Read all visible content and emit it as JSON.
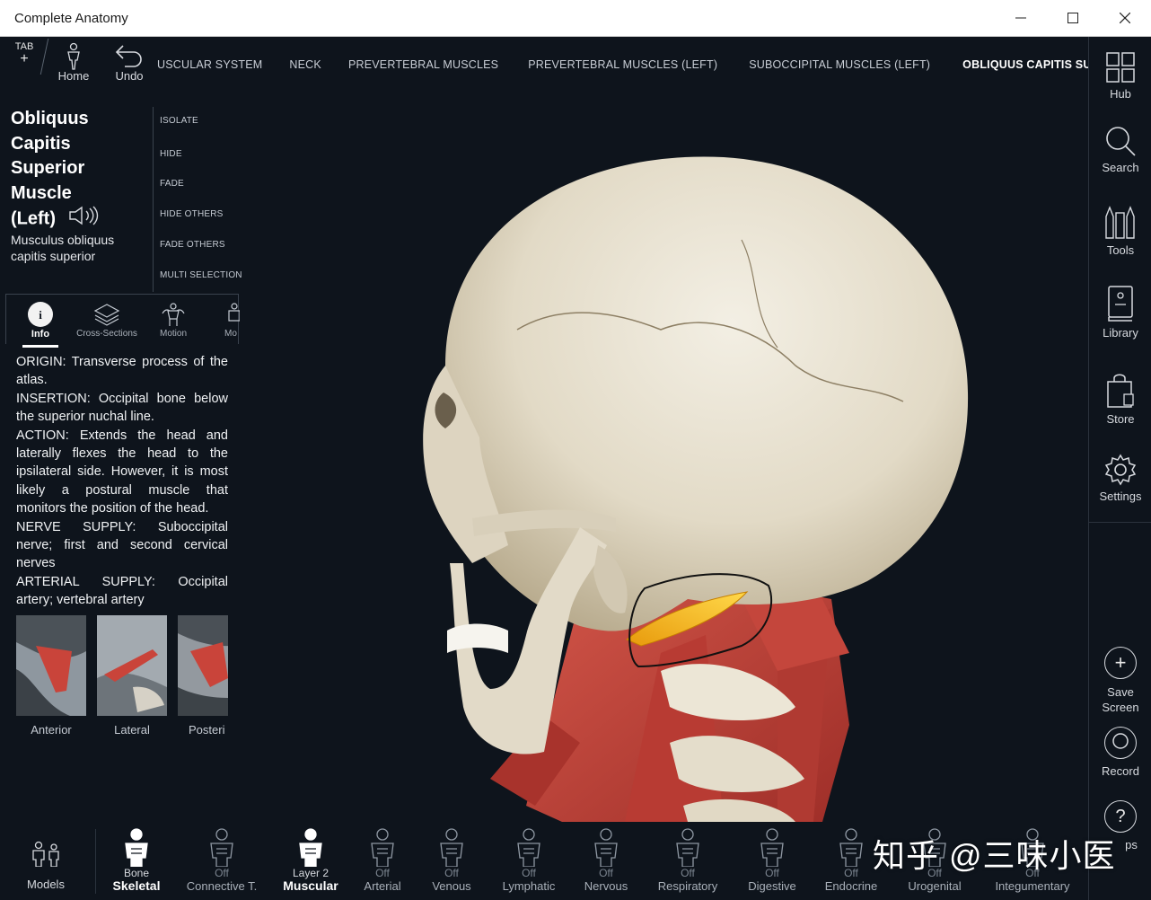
{
  "window": {
    "title": "Complete Anatomy",
    "minimize": "—",
    "maximize": "☐",
    "close": "✕"
  },
  "toolbar": {
    "tab_label": "TAB",
    "tab_plus": "+",
    "home_label": "Home",
    "undo_label": "Undo",
    "breadcrumbs": [
      "USCULAR SYSTEM",
      "NECK",
      "PREVERTEBRAL MUSCLES",
      "PREVERTEBRAL MUSCLES (LEFT)",
      "SUBOCCIPITAL MUSCLES (LEFT)",
      "OBLIQUUS CAPITIS SUPERIOR MUSCLE (LE"
    ]
  },
  "right_sidebar": {
    "items": [
      "Hub",
      "Search",
      "Tools",
      "Library",
      "Store",
      "Settings"
    ],
    "save_screen": "Save\nScreen",
    "record": "Record",
    "help": "Help",
    "help_partial": "ps"
  },
  "structure": {
    "title_lines": [
      "Obliquus",
      "Capitis",
      "Superior",
      "Muscle",
      "(Left)"
    ],
    "latin_lines": [
      "Musculus obliquus",
      "capitis superior"
    ],
    "actions": [
      "ISOLATE",
      "HIDE",
      "FADE",
      "HIDE OTHERS",
      "FADE OTHERS",
      "MULTI SELECTION"
    ]
  },
  "info_tabs": [
    "Info",
    "Cross-Sections",
    "Motion",
    "Mo"
  ],
  "info_text": {
    "origin": "ORIGIN: Transverse process of the atlas.",
    "insertion": "INSERTION: Occipital bone below the superior nuchal line.",
    "action": "ACTION: Extends the head and laterally flexes the head to the ipsilateral side. However, it is most likely a postural muscle that monitors the position of the head.",
    "nerve": "NERVE SUPPLY: Suboccipital nerve; first and second cervical nerves",
    "arterial": "ARTERIAL SUPPLY: Occipital artery; vertebral artery"
  },
  "thumbnails": [
    "Anterior",
    "Lateral",
    "Posteri"
  ],
  "bottom_bar": {
    "models": "Models",
    "systems": [
      {
        "state": "Bone",
        "name": "Skeletal",
        "on": true
      },
      {
        "state": "Off",
        "name": "Connective T.",
        "on": false
      },
      {
        "state": "Layer 2",
        "name": "Muscular",
        "on": true
      },
      {
        "state": "Off",
        "name": "Arterial",
        "on": false
      },
      {
        "state": "Off",
        "name": "Venous",
        "on": false
      },
      {
        "state": "Off",
        "name": "Lymphatic",
        "on": false
      },
      {
        "state": "Off",
        "name": "Nervous",
        "on": false
      },
      {
        "state": "Off",
        "name": "Respiratory",
        "on": false
      },
      {
        "state": "Off",
        "name": "Digestive",
        "on": false
      },
      {
        "state": "Off",
        "name": "Endocrine",
        "on": false
      },
      {
        "state": "Off",
        "name": "Urogenital",
        "on": false
      },
      {
        "state": "Off",
        "name": "Integumentary",
        "on": false
      }
    ]
  },
  "watermark": "知乎 @三味小医",
  "colors": {
    "background": "#0e141c",
    "muscle": "#c0443a",
    "highlight": "#f2b316",
    "bone": "#e8e2d2",
    "annotation": "#111111"
  }
}
